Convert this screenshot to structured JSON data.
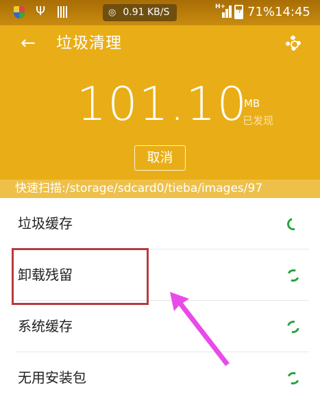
{
  "status_bar": {
    "network_speed": "0.91 KB/S",
    "network_type": "H+",
    "battery_percent": "71%",
    "battery_level": 0.71,
    "time": "14:45",
    "icons": [
      "shield-icon",
      "usb-icon",
      "sd-card-icon",
      "hotspot-icon",
      "signal-icon",
      "battery-icon"
    ]
  },
  "header": {
    "back_icon": "arrow-left-icon",
    "title": "垃圾清理",
    "settings_icon": "gear-icon"
  },
  "summary": {
    "amount": "101.10",
    "unit": "MB",
    "caption": "已发现",
    "cancel_label": "取消"
  },
  "scan_status": "快速扫描:/storage/sdcard0/tieba/images/97",
  "items": [
    {
      "label": "垃圾缓存",
      "icon": "loading-spinner-icon"
    },
    {
      "label": "卸载残留",
      "icon": "loading-spinner-icon"
    },
    {
      "label": "系统缓存",
      "icon": "loading-spinner-icon"
    },
    {
      "label": "无用安装包",
      "icon": "loading-spinner-icon"
    }
  ],
  "annotation": {
    "highlight_color": "#b83a3f",
    "arrow_color": "#e94be8"
  },
  "colors": {
    "accent": "#e9ae17",
    "spinner": "#27a33a"
  }
}
